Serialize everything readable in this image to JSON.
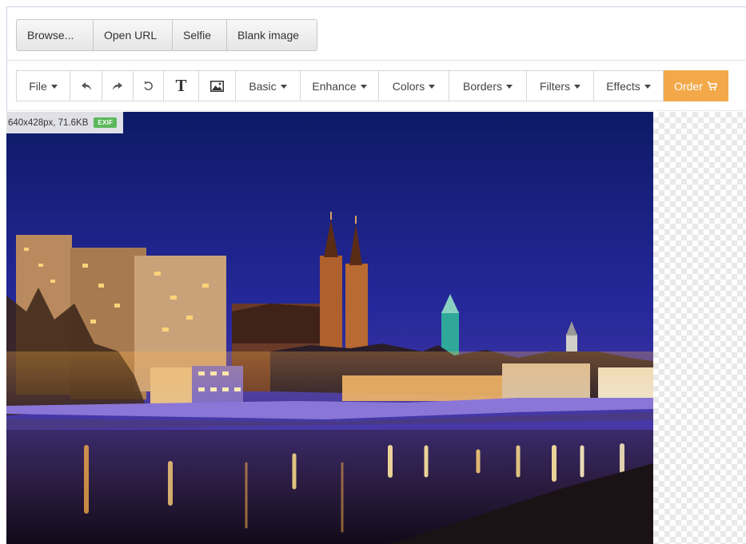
{
  "top_buttons": [
    "Browse...",
    "Open URL",
    "Selfie",
    "Blank image"
  ],
  "toolbar": {
    "file": "File",
    "undo_icon": "undo-icon",
    "redo_icon": "redo-icon",
    "reset_icon": "reset-icon",
    "text_icon": "T",
    "image_icon": "image-icon",
    "basic": "Basic",
    "enhance": "Enhance",
    "colors": "Colors",
    "borders": "Borders",
    "filters": "Filters",
    "effects": "Effects",
    "order": "Order",
    "order_icon": "cart-icon"
  },
  "image_info": {
    "dimensions": "640x428px, 71.6KB",
    "exif_badge": "EXIF"
  },
  "colors": {
    "order_button": "#f3a94a",
    "exif_badge": "#5cb85c"
  }
}
